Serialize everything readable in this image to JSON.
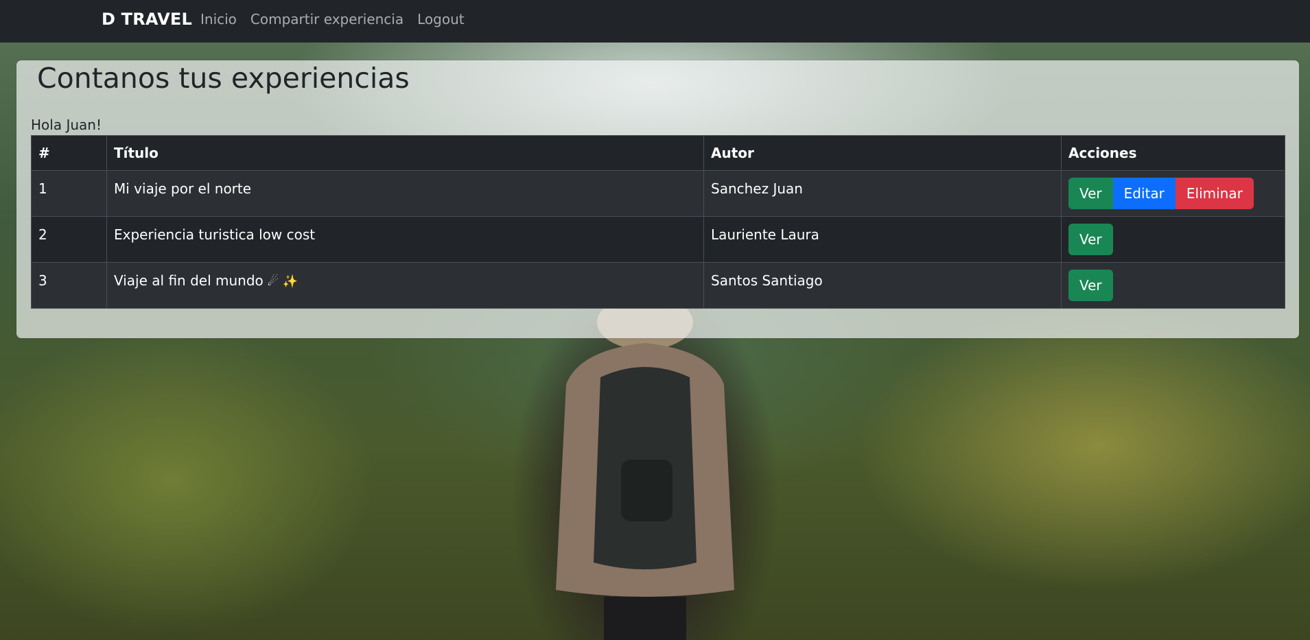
{
  "navbar": {
    "brand": "D TRAVEL",
    "links": [
      "Inicio",
      "Compartir experiencia",
      "Logout"
    ]
  },
  "main": {
    "title": "Contanos tus experiencias",
    "greeting": "Hola Juan!",
    "table": {
      "headers": [
        "#",
        "Título",
        "Autor",
        "Acciones"
      ],
      "rows": [
        {
          "num": "1",
          "title": "Mi viaje por el norte",
          "author": "Sanchez Juan"
        },
        {
          "num": "2",
          "title": "Experiencia turistica low cost",
          "author": "Lauriente Laura"
        },
        {
          "num": "3",
          "title": "Viaje al fin del mundo",
          "emoji": "☄ ✨",
          "author": "Santos Santiago"
        }
      ]
    },
    "actions": {
      "view": "Ver",
      "edit": "Editar",
      "delete": "Eliminar"
    }
  },
  "colors": {
    "navbar": "#212529",
    "view_button": "#198754",
    "edit_button": "#0d6efd",
    "delete_button": "#dc3545"
  }
}
